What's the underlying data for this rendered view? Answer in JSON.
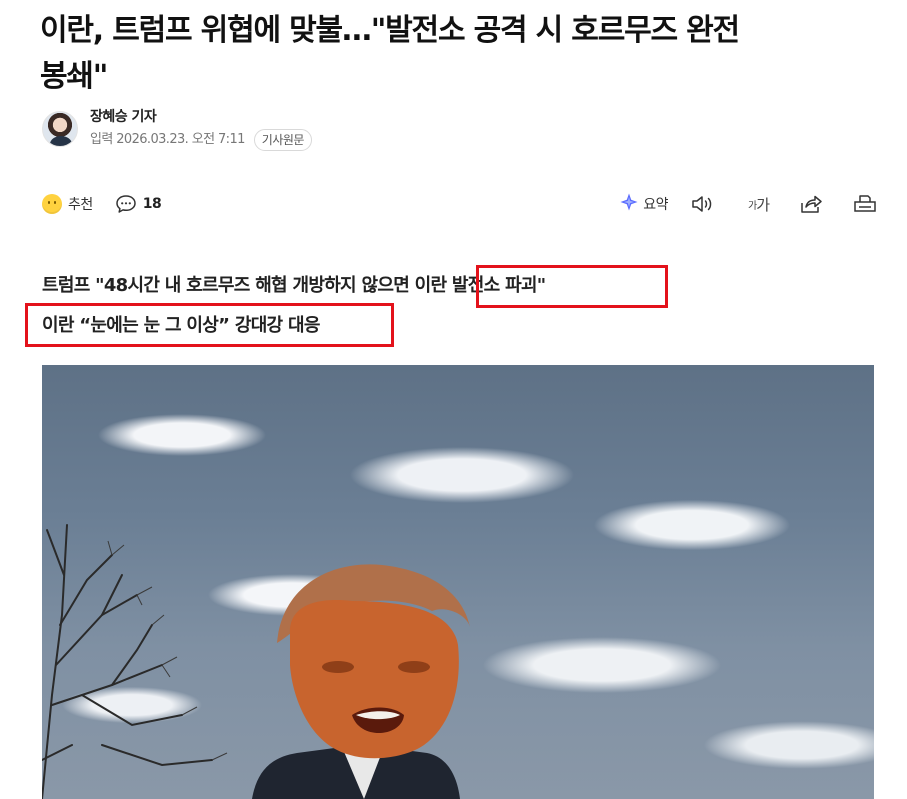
{
  "article": {
    "headline_line1": "이란, 트럼프 위협에 맞불…\"발전소 공격 시 호르무즈 완전",
    "headline_line2": "봉쇄\"",
    "reporter": "장혜승 기자",
    "published": "입력 2026.03.23. 오전 7:11",
    "original_link_label": "기사원문",
    "subhead_line1_part1": "트럼프 \"48시간 내 호르무즈 해협 개방하지 않으면 ",
    "subhead_line1_part2": "이란 발전소 파괴\"",
    "subhead_line2": "이란 “눈에는 눈 그 이상” 강대강 대응"
  },
  "toolbar": {
    "recommend_label": "추천",
    "comment_count": "18",
    "summary_label": "요약",
    "font_size_label_small": "가",
    "font_size_label_large": "가"
  },
  "icons": {
    "recommend": "smile-icon",
    "comments": "speech-bubble-icon",
    "summary": "sparkle-icon",
    "audio": "speaker-icon",
    "font_size": "font-size-icon",
    "share": "share-icon",
    "print": "print-icon"
  },
  "colors": {
    "highlight_box": "#e3121b",
    "text_primary": "#111111",
    "text_meta": "#777777",
    "recommend_icon": "#ffd23f",
    "summary_icon": "#5b6cff"
  }
}
